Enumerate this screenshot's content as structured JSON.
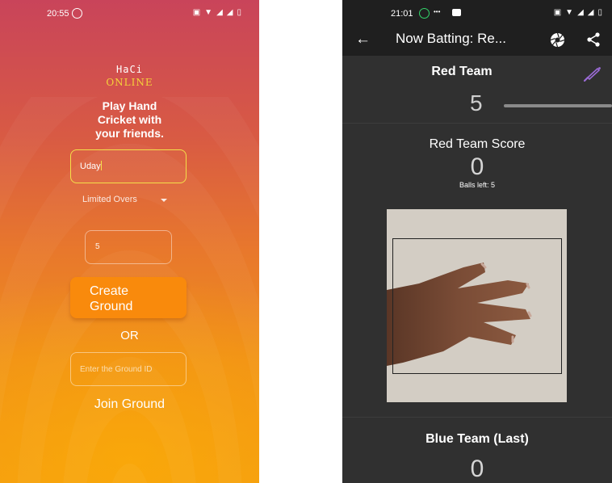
{
  "left_screen": {
    "status_bar": {
      "time": "20:55"
    },
    "logo": {
      "line1": "HaCi",
      "line2": "ONLINE"
    },
    "tagline": [
      "Play Hand",
      "Cricket with",
      "your friends."
    ],
    "name_input": {
      "value": "Uday"
    },
    "mode_select": {
      "selected": "Limited Overs"
    },
    "overs_input": {
      "value": "5"
    },
    "create_button": {
      "label_line1": "Create",
      "label_line2": "Ground"
    },
    "or_text": "OR",
    "ground_id_input": {
      "placeholder": "Enter the Ground ID"
    },
    "join_link": "Join Ground",
    "colors": {
      "gradient_top": "#c9445a",
      "gradient_bottom": "#f39a14",
      "button": "#f98a0c",
      "input_focus": "#f4e04a",
      "logo_accent": "#f5d23a"
    }
  },
  "right_screen": {
    "status_bar": {
      "time": "21:01"
    },
    "app_bar": {
      "title": "Now Batting: Re...",
      "icons": [
        "back-arrow-icon",
        "aperture-icon",
        "share-icon"
      ]
    },
    "batting_team": {
      "name": "Red Team",
      "balls_selected": "5",
      "icon": "cricket-bat-icon"
    },
    "score": {
      "label": "Red Team Score",
      "value": "0",
      "balls_left": "Balls left: 5"
    },
    "camera": {
      "detection_box": true
    },
    "opponent": {
      "name": "Blue Team (Last)",
      "score": "0"
    },
    "colors": {
      "background": "#303030",
      "bar": "#1f1f1f",
      "bat_icon": "#9b6bd6"
    }
  }
}
